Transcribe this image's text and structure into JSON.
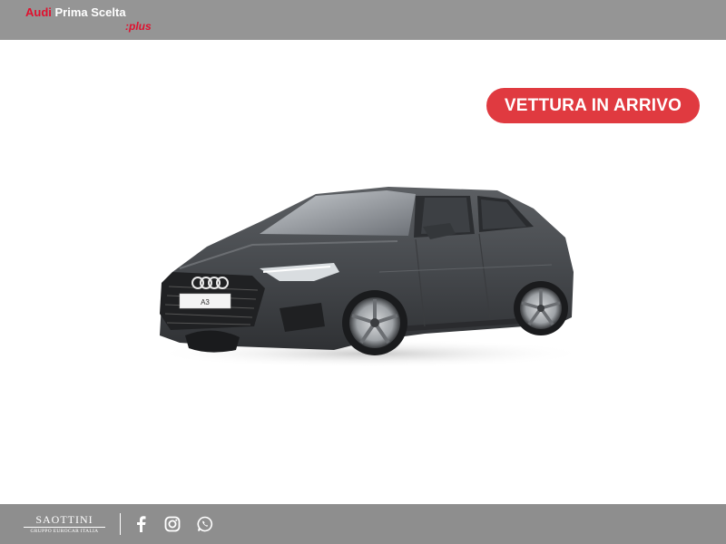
{
  "header": {
    "brand_audi": "Audi",
    "brand_name": "Prima Scelta",
    "brand_plus": ":plus"
  },
  "badge": {
    "label": "VETTURA IN ARRIVO",
    "color": "#e03a40"
  },
  "car": {
    "plate": "A3",
    "body_color": "#4a4d51"
  },
  "footer": {
    "dealer_name": "SAOTTINI",
    "dealer_group": "GRUPPO EUROCAR ITALIA",
    "social": [
      {
        "icon": "facebook-icon"
      },
      {
        "icon": "instagram-icon"
      },
      {
        "icon": "whatsapp-icon"
      }
    ]
  },
  "colors": {
    "header_bg": "#959595",
    "footer_bg": "#8e8e8e",
    "brand_red": "#e0102e"
  }
}
